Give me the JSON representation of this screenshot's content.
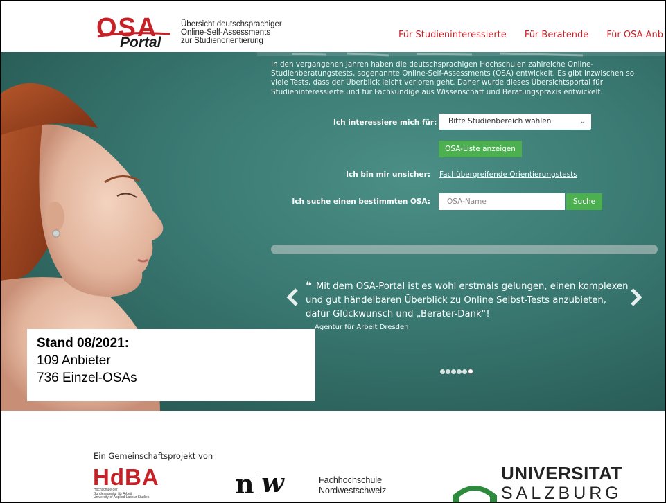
{
  "header": {
    "logo": {
      "osa": "OSA",
      "portal": "Portal"
    },
    "description": [
      "Übersicht deutschsprachiger",
      "Online-Self-Assessments",
      "zur Studienorientierung"
    ],
    "nav": [
      "Für Studieninteressierte",
      "Für Beratende",
      "Für OSA-Anb"
    ]
  },
  "hero": {
    "intro": "In den vergangenen Jahren haben die deutschsprachigen Hochschulen zahlreiche Online-Studienberatungstests, sogenannte Online-Self-Assessments (OSA) entwickelt. Es gibt inzwischen so viele Tests, dass der Überblick leicht verloren geht. Daher wurde dieses Übersichtsportal für Studieninteressierte und für Fachkundige aus Wissenschaft und Beratungspraxis entwickelt.",
    "interest_label": "Ich interessiere mich für:",
    "select_value": "Bitte Studienbereich wählen",
    "list_button": "OSA-Liste anzeigen",
    "unsure_label": "Ich bin mir unsicher:",
    "orientation_link": "Fachübergreifende Orientierungstests",
    "search_label": "Ich suche einen bestimmten OSA:",
    "search_placeholder": "OSA-Name",
    "search_button": "Suche",
    "quote_mark": "❝",
    "quote": "Mit dem OSA-Portal ist es wohl erstmals gelungen, einen komplexen und gut händelbaren Überblick zu Online Selbst-Tests anzubieten, dafür Glückwunsch und „Berater-Dank“!",
    "quote_author": "Agentur für Arbeit Dresden",
    "carousel": {
      "count": 6,
      "active": 6
    }
  },
  "stand": {
    "heading": "Stand 08/2021:",
    "providers": "109 Anbieter",
    "osas": "736 Einzel-OSAs"
  },
  "footer": {
    "title": "Ein Gemeinschaftsprojekt von",
    "hdba": {
      "name": "HdBA",
      "sub": [
        "Hochschule der",
        "Bundesagentur für Arbeit",
        "University of Applied Labour Studies"
      ]
    },
    "fhnw": {
      "mark_n": "n",
      "mark_w": "w",
      "text": [
        "Fachhochschule",
        "Nordwestschweiz"
      ]
    },
    "salzburg": {
      "line1": "UNIVERSITAT",
      "line2": "SALZBURG"
    }
  },
  "colors": {
    "brand_red": "#c62127",
    "hero_teal": "#3a7a73",
    "button_green": "#4caf50"
  }
}
